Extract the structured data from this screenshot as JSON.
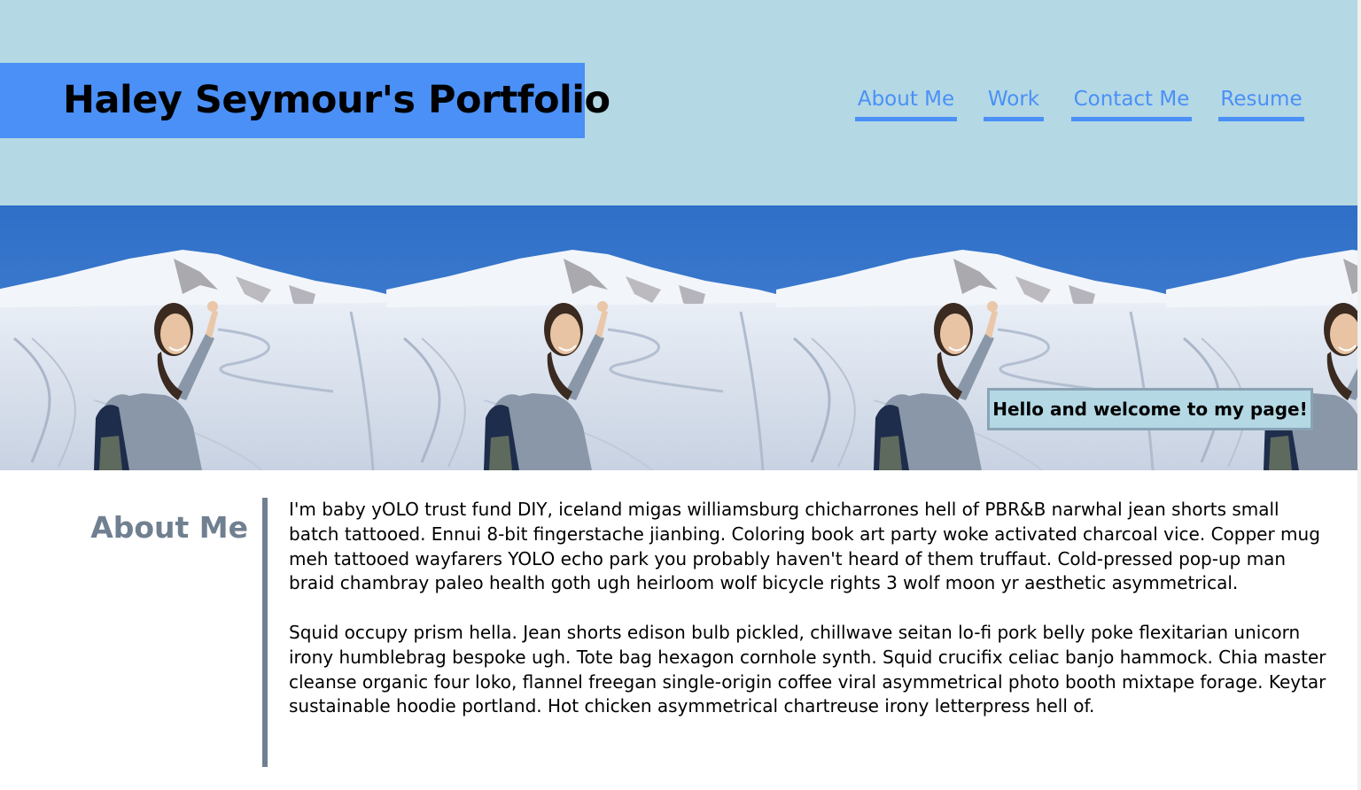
{
  "header": {
    "title": "Haley Seymour's Portfolio",
    "nav": [
      {
        "label": "About Me"
      },
      {
        "label": "Work"
      },
      {
        "label": "Contact Me"
      },
      {
        "label": "Resume"
      }
    ]
  },
  "hero": {
    "welcome": "Hello and welcome to my page!"
  },
  "about": {
    "heading": "About Me",
    "paragraphs": [
      "I'm baby yOLO trust fund DIY, iceland migas williamsburg chicharrones hell of PBR&B narwhal jean shorts small batch tattooed. Ennui 8-bit fingerstache jianbing. Coloring book art party woke activated charcoal vice. Copper mug meh tattooed wayfarers YOLO echo park you probably haven't heard of them truffaut. Cold-pressed pop-up man braid chambray paleo health goth ugh heirloom wolf bicycle rights 3 wolf moon yr aesthetic asymmetrical.",
      "Squid occupy prism hella. Jean shorts edison bulb pickled, chillwave seitan lo-fi pork belly poke flexitarian unicorn irony humblebrag bespoke ugh. Tote bag hexagon cornhole synth. Squid crucifix celiac banjo hammock. Chia master cleanse organic four loko, flannel freegan single-origin coffee viral asymmetrical photo booth mixtape forage. Keytar sustainable hoodie portland. Hot chicken asymmetrical chartreuse irony letterpress hell of."
    ]
  },
  "colors": {
    "header_bg": "#b4d8e4",
    "accent_blue": "#4a90f7",
    "slate": "#708090"
  }
}
